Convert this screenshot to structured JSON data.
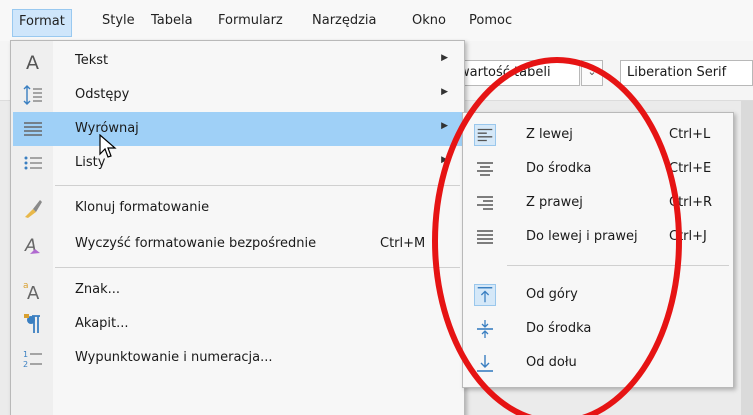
{
  "menubar": {
    "items": [
      "Format",
      "Style",
      "Tabela",
      "Formularz",
      "Narzędzia",
      "Okno",
      "Pomoc"
    ],
    "active_index": 0
  },
  "toolbar": {
    "paragraph_style_value": "wartość tabeli",
    "font_name_value": "Liberation Serif"
  },
  "format_menu": {
    "items": [
      {
        "icon": "text-a-icon",
        "label": "Tekst",
        "has_submenu": true
      },
      {
        "icon": "spacing-icon",
        "label": "Odstępy",
        "has_submenu": true
      },
      {
        "icon": "align-justify-icon",
        "label": "Wyrównaj",
        "has_submenu": true,
        "highlighted": true
      },
      {
        "icon": "list-icon",
        "label": "Listy",
        "has_submenu": true
      },
      {
        "icon": "clone-formatting-icon",
        "label": "Klonuj formatowanie"
      },
      {
        "icon": "clear-formatting-icon",
        "label": "Wyczyść formatowanie bezpośrednie",
        "shortcut": "Ctrl+M"
      },
      {
        "icon": "character-icon",
        "label": "Znak..."
      },
      {
        "icon": "paragraph-icon",
        "label": "Akapit..."
      },
      {
        "icon": "bullets-numbering-icon",
        "label": "Wypunktowanie i numeracja..."
      }
    ]
  },
  "align_submenu": {
    "items": [
      {
        "icon": "align-left-icon",
        "label": "Z lewej",
        "shortcut": "Ctrl+L",
        "selected": true
      },
      {
        "icon": "align-center-icon",
        "label": "Do środka",
        "shortcut": "Ctrl+E"
      },
      {
        "icon": "align-right-icon",
        "label": "Z prawej",
        "shortcut": "Ctrl+R"
      },
      {
        "icon": "align-justify-icon",
        "label": "Do lewej i prawej",
        "shortcut": "Ctrl+J"
      },
      {
        "icon": "align-top-icon",
        "label": "Od góry",
        "selected": true
      },
      {
        "icon": "align-middle-icon",
        "label": "Do środka"
      },
      {
        "icon": "align-bottom-icon",
        "label": "Od dołu"
      }
    ]
  },
  "colors": {
    "highlight": "#9fd0f7",
    "annotation": "#e61414",
    "icon_blue": "#3a7fc1"
  }
}
